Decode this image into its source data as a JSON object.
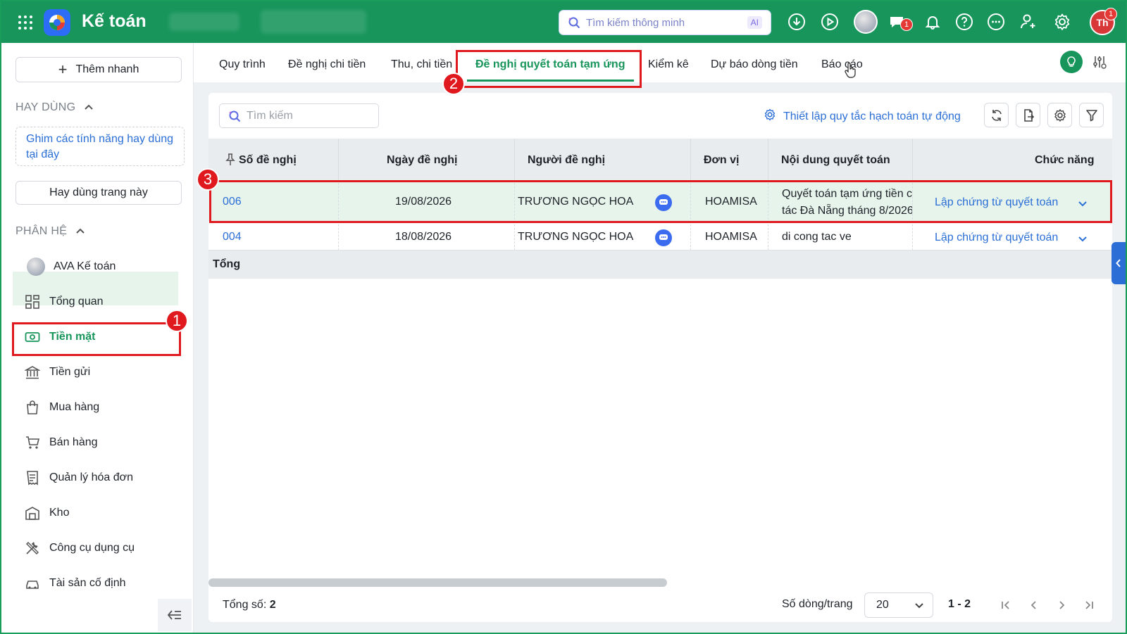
{
  "header": {
    "app_title": "Kế toán",
    "smart_search_placeholder": "Tìm kiếm thông minh",
    "ai_label": "AI",
    "chat_badge": "1",
    "user_initials": "Th",
    "user_badge": "1",
    "accent_color": "#17955a"
  },
  "sidebar": {
    "quick_add_label": "Thêm nhanh",
    "favorites_title": "HAY DÙNG",
    "favorites_hint": "Ghim các tính năng hay dùng tại đây",
    "favorite_this_page": "Hay dùng trang này",
    "modules_title": "PHÂN HỆ",
    "items": [
      {
        "label": "AVA Kế toán",
        "icon": "ava-avatar-icon"
      },
      {
        "label": "Tổng quan",
        "icon": "dashboard-icon"
      },
      {
        "label": "Tiền mặt",
        "icon": "cash-icon",
        "active": true
      },
      {
        "label": "Tiền gửi",
        "icon": "bank-icon"
      },
      {
        "label": "Mua hàng",
        "icon": "shopping-bag-icon"
      },
      {
        "label": "Bán hàng",
        "icon": "cart-icon"
      },
      {
        "label": "Quản lý hóa đơn",
        "icon": "invoice-icon"
      },
      {
        "label": "Kho",
        "icon": "warehouse-icon"
      },
      {
        "label": "Công cụ dụng cụ",
        "icon": "tools-icon"
      },
      {
        "label": "Tài sản cố định",
        "icon": "car-icon"
      }
    ]
  },
  "tabs": [
    {
      "label": "Quy trình"
    },
    {
      "label": "Đề nghị chi tiền"
    },
    {
      "label": "Thu, chi tiền"
    },
    {
      "label": "Đề nghị quyết toán tạm ứng",
      "active": true
    },
    {
      "label": "Kiểm kê"
    },
    {
      "label": "Dự báo dòng tiền"
    },
    {
      "label": "Báo cáo"
    }
  ],
  "toolbar": {
    "search_placeholder": "Tìm kiếm",
    "setup_link": "Thiết lập quy tắc hạch toán tự động"
  },
  "table": {
    "columns": [
      "Số đề nghị",
      "Ngày đề nghị",
      "Người đề nghị",
      "Đơn vị",
      "Nội dung quyết toán",
      "Chức năng"
    ],
    "rows": [
      {
        "number": "006",
        "date": "19/08/2026",
        "requester": "TRƯƠNG NGỌC HOA",
        "unit": "HOAMISA",
        "content_line1": "Quyết toán tạm ứng tiền công",
        "content_line2": "tác Đà Nẵng tháng 8/2026",
        "action": "Lập chứng từ quyết toán"
      },
      {
        "number": "004",
        "date": "18/08/2026",
        "requester": "TRƯƠNG NGỌC HOA",
        "unit": "HOAMISA",
        "content_line1": "di cong tac ve",
        "action": "Lập chứng từ quyết toán"
      }
    ],
    "total_label": "Tổng"
  },
  "footer": {
    "total_label": "Tổng số:",
    "total_value": "2",
    "rows_per_page_label": "Số dòng/trang",
    "rows_per_page": "20",
    "range": "1 - 2"
  },
  "annotations": [
    "1",
    "2",
    "3"
  ]
}
